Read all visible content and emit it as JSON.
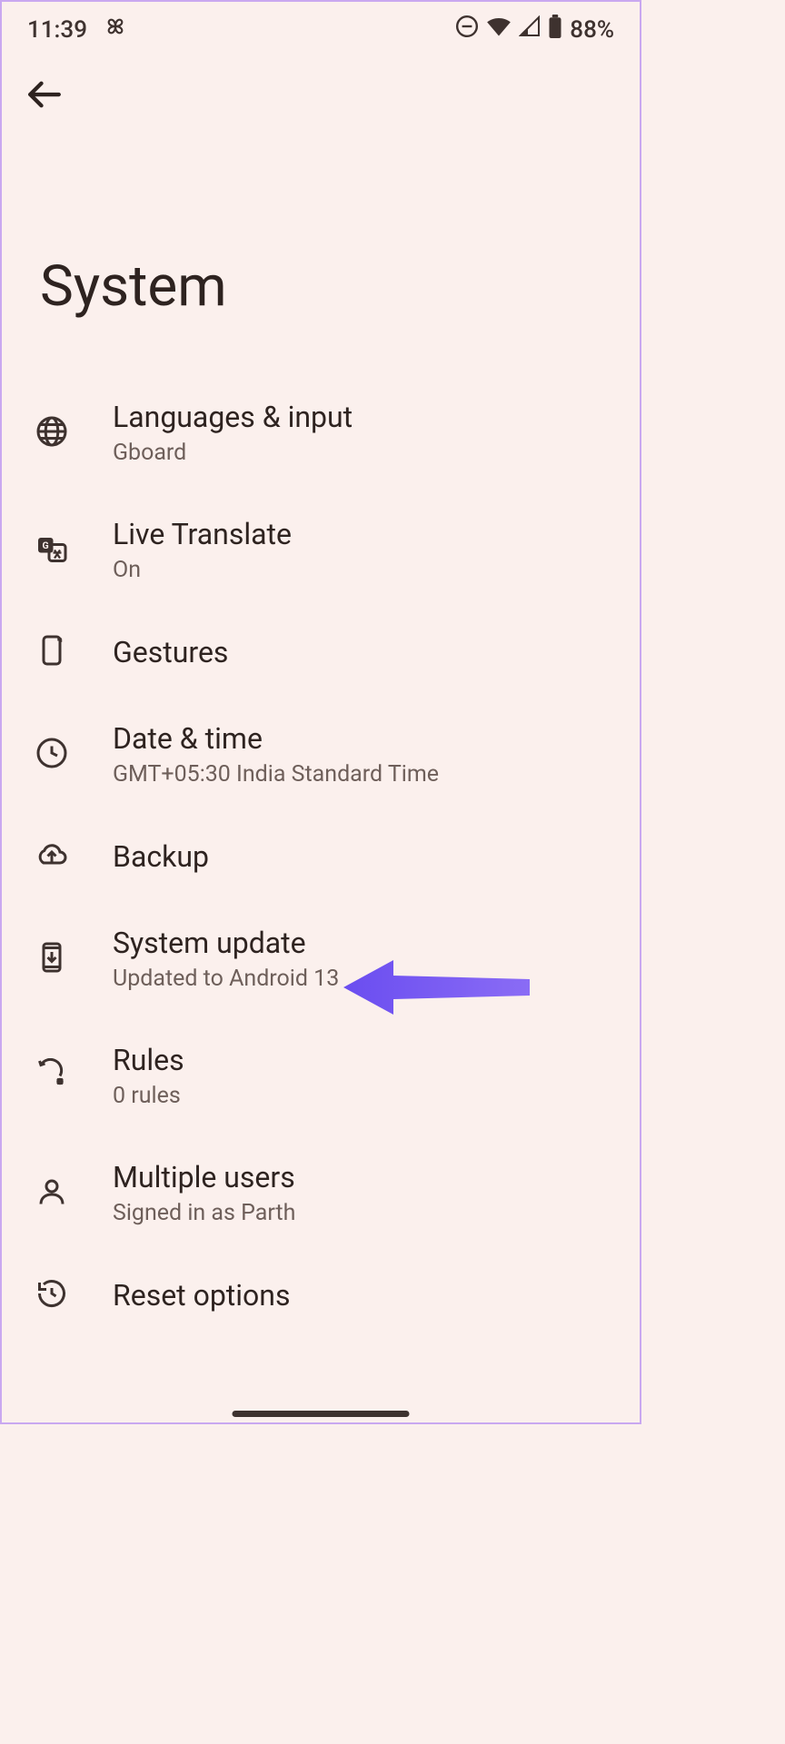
{
  "status_bar": {
    "time": "11:39",
    "battery": "88%"
  },
  "page_title": "System",
  "items": [
    {
      "title": "Languages & input",
      "subtitle": "Gboard"
    },
    {
      "title": "Live Translate",
      "subtitle": "On"
    },
    {
      "title": "Gestures",
      "subtitle": ""
    },
    {
      "title": "Date & time",
      "subtitle": "GMT+05:30 India Standard Time"
    },
    {
      "title": "Backup",
      "subtitle": ""
    },
    {
      "title": "System update",
      "subtitle": "Updated to Android 13"
    },
    {
      "title": "Rules",
      "subtitle": "0 rules"
    },
    {
      "title": "Multiple users",
      "subtitle": "Signed in as Parth"
    },
    {
      "title": "Reset options",
      "subtitle": ""
    }
  ]
}
